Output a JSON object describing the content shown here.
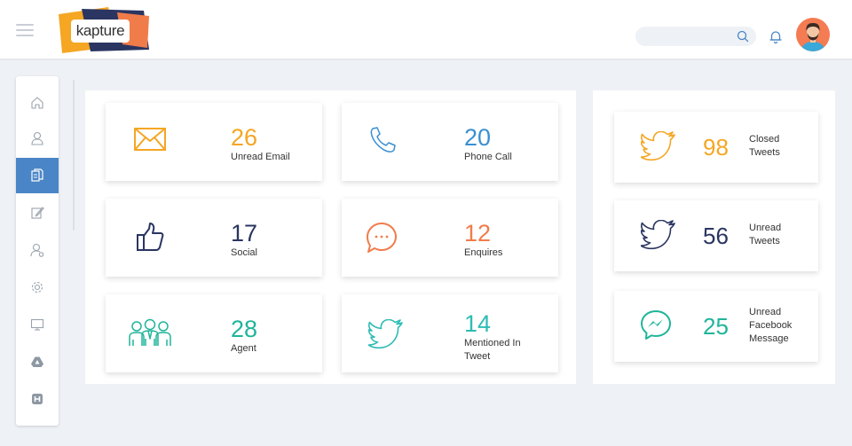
{
  "header": {
    "logo_text": "kapture",
    "search": {
      "placeholder": ""
    }
  },
  "sidebar": {
    "items": [
      {
        "icon": "home-icon",
        "active": false
      },
      {
        "icon": "user-icon",
        "active": false
      },
      {
        "icon": "documents-icon",
        "active": true
      },
      {
        "icon": "edit-icon",
        "active": false
      },
      {
        "icon": "user-settings-icon",
        "active": false
      },
      {
        "icon": "gear-icon",
        "active": false
      },
      {
        "icon": "monitor-icon",
        "active": false
      },
      {
        "icon": "drive-icon",
        "active": false
      },
      {
        "icon": "h-square-icon",
        "active": false
      }
    ]
  },
  "stats": [
    {
      "value": "26",
      "label": "Unread Email",
      "icon": "mail-icon",
      "color": "#f5a623"
    },
    {
      "value": "20",
      "label": "Phone Call",
      "icon": "phone-icon",
      "color": "#3a8fd1"
    },
    {
      "value": "17",
      "label": "Social",
      "icon": "thumbs-up-icon",
      "color": "#2a3561"
    },
    {
      "value": "12",
      "label": "Enquires",
      "icon": "chat-bubble-icon",
      "color": "#f07c4a"
    },
    {
      "value": "28",
      "label": "Agent",
      "icon": "agents-icon",
      "color": "#1fb59a"
    },
    {
      "value": "14",
      "label": "Mentioned In Tweet",
      "label_lines": [
        "Mentioned In",
        "Tweet"
      ],
      "icon": "twitter-icon",
      "color": "#2ebcb4"
    }
  ],
  "social": [
    {
      "value": "98",
      "label_lines": [
        "Closed",
        "Tweets"
      ],
      "icon": "twitter-icon",
      "color": "#f5a623"
    },
    {
      "value": "56",
      "label_lines": [
        "Unread",
        "Tweets"
      ],
      "icon": "twitter-icon",
      "color": "#2a3561"
    },
    {
      "value": "25",
      "label_lines": [
        "Unread",
        "Facebook",
        "Message"
      ],
      "icon": "messenger-icon",
      "color": "#1fb59a"
    }
  ]
}
